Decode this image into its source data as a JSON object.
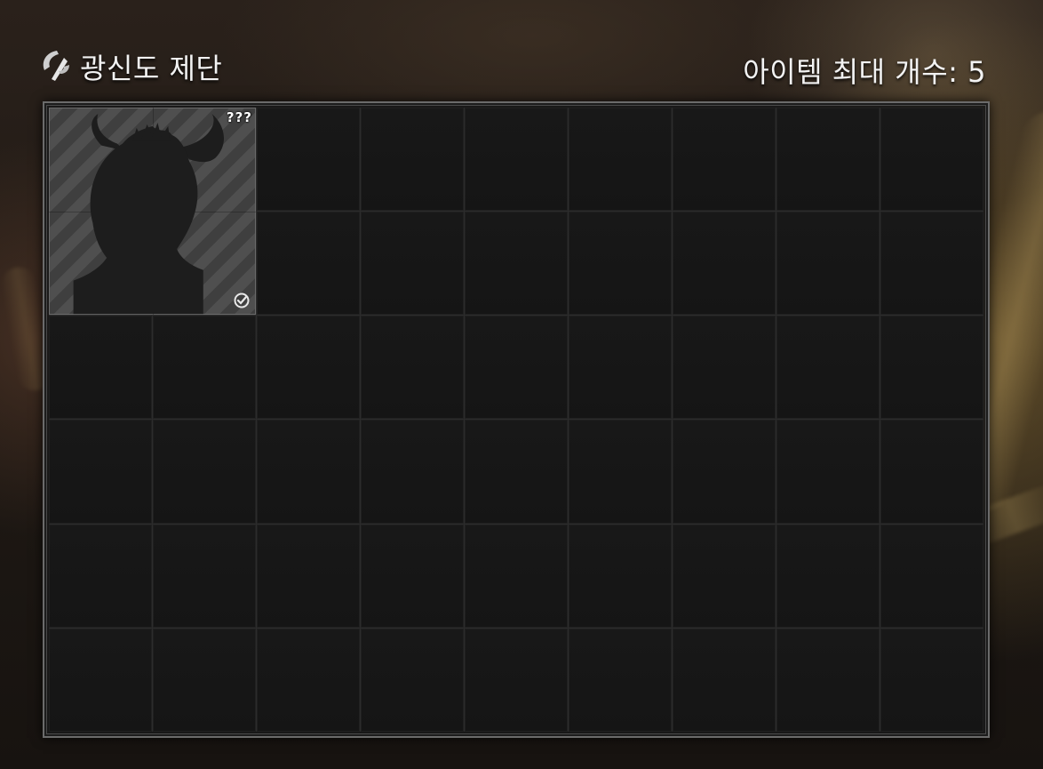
{
  "panel": {
    "title": "광신도 제단",
    "max_item_count_label": "아이템 최대 개수: 5",
    "emblem_icon": "crescent-claw-icon"
  },
  "grid": {
    "columns": 9,
    "rows": 6
  },
  "items": [
    {
      "name": "unknown-horned-silhouette",
      "label": "???",
      "icon": "horned-head-silhouette-icon",
      "status_icon": "check-circle-icon",
      "span_columns": 2,
      "span_rows": 2
    }
  ],
  "colors": {
    "frame_border": "#6b6b6b",
    "cell_bg": "#161616",
    "item_stripe_light": "#4f4f4f",
    "item_stripe_dark": "#3f3f3f",
    "title_text": "#f2f2f2"
  }
}
